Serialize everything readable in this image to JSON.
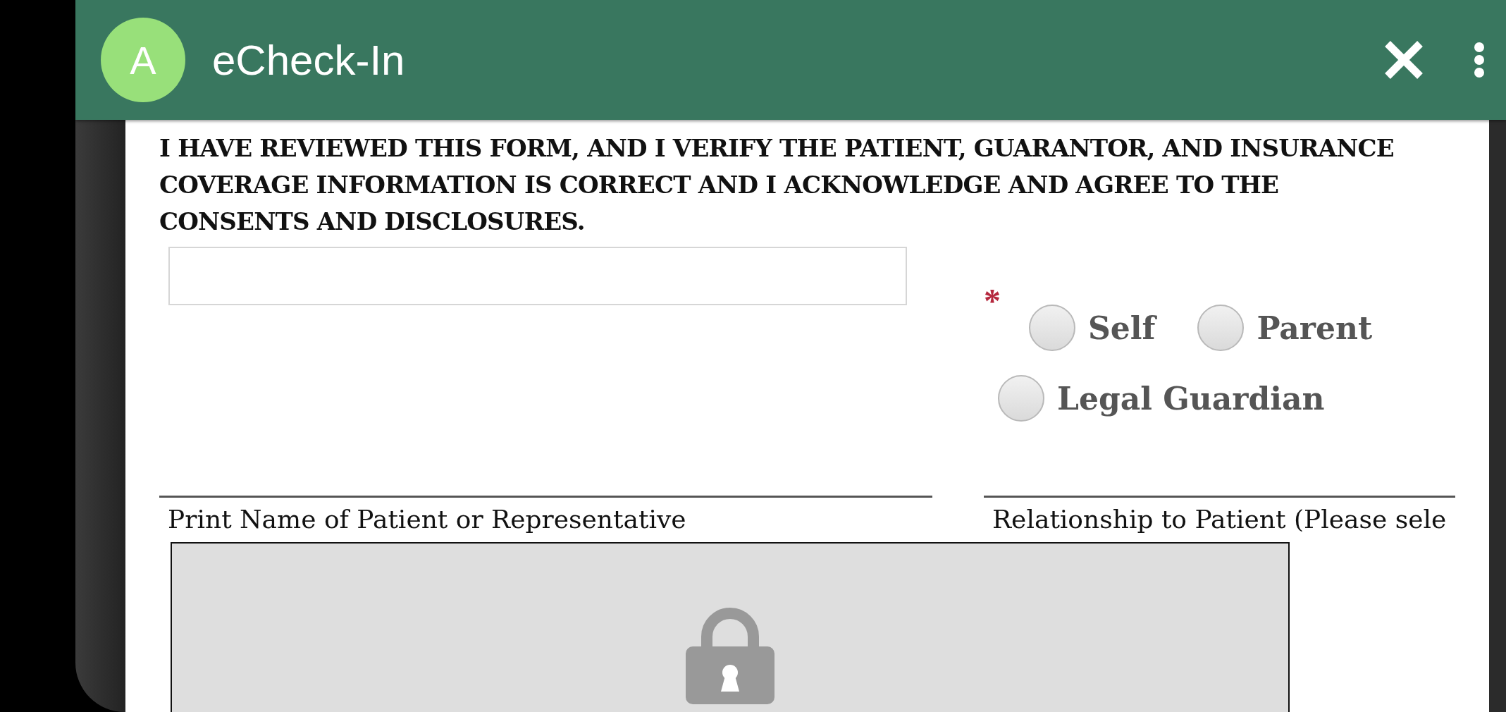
{
  "app_bar": {
    "avatar": "A",
    "title": "eCheck-In"
  },
  "statement": "I HAVE REVIEWED THIS FORM, AND I VERIFY THE PATIENT, GUARANTOR, AND INSURANCE COVERAGE INFORMATION IS CORRECT AND I ACKNOWLEDGE AND AGREE TO THE CONSENTS AND DISCLOSURES.",
  "relationship": {
    "required": true,
    "required_mark": "*",
    "options": [
      {
        "label": "Self",
        "selected": false
      },
      {
        "label": "Parent",
        "selected": false
      },
      {
        "label": "Legal Guardian",
        "selected": false
      }
    ]
  },
  "name_label": "Print Name of Patient or Representative",
  "relationship_label": "Relationship to Patient (Please sele",
  "signature": {
    "locked": true
  }
}
